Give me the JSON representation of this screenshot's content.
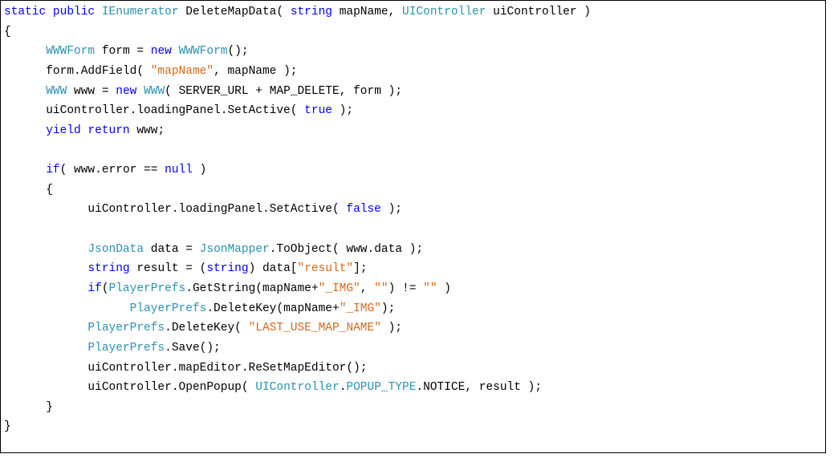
{
  "code": {
    "tokens": [
      [
        {
          "t": "static public",
          "c": "kw-blue"
        },
        {
          "t": " ",
          "c": "plain"
        },
        {
          "t": "IEnumerator",
          "c": "kw-teal"
        },
        {
          "t": " DeleteMapData( ",
          "c": "plain"
        },
        {
          "t": "string",
          "c": "kw-blue"
        },
        {
          "t": " mapName, ",
          "c": "plain"
        },
        {
          "t": "UIController",
          "c": "kw-teal"
        },
        {
          "t": " uiController )",
          "c": "plain"
        }
      ],
      [
        {
          "t": "{",
          "c": "plain"
        }
      ],
      [
        {
          "t": "      ",
          "c": "plain"
        },
        {
          "t": "WWWForm",
          "c": "kw-teal"
        },
        {
          "t": " form = ",
          "c": "plain"
        },
        {
          "t": "new",
          "c": "kw-blue"
        },
        {
          "t": " ",
          "c": "plain"
        },
        {
          "t": "WWWForm",
          "c": "kw-teal"
        },
        {
          "t": "();",
          "c": "plain"
        }
      ],
      [
        {
          "t": "      form.AddField( ",
          "c": "plain"
        },
        {
          "t": "\"mapName\"",
          "c": "str"
        },
        {
          "t": ", mapName );",
          "c": "plain"
        }
      ],
      [
        {
          "t": "      ",
          "c": "plain"
        },
        {
          "t": "WWW",
          "c": "kw-teal"
        },
        {
          "t": " www = ",
          "c": "plain"
        },
        {
          "t": "new",
          "c": "kw-blue"
        },
        {
          "t": " ",
          "c": "plain"
        },
        {
          "t": "WWW",
          "c": "kw-teal"
        },
        {
          "t": "( SERVER_URL + MAP_DELETE, form );",
          "c": "plain"
        }
      ],
      [
        {
          "t": "      uiController.loadingPanel.SetActive( ",
          "c": "plain"
        },
        {
          "t": "true",
          "c": "kw-blue"
        },
        {
          "t": " );",
          "c": "plain"
        }
      ],
      [
        {
          "t": "      ",
          "c": "plain"
        },
        {
          "t": "yield return",
          "c": "kw-blue"
        },
        {
          "t": " www;",
          "c": "plain"
        }
      ],
      [
        {
          "t": " ",
          "c": "plain"
        }
      ],
      [
        {
          "t": "      ",
          "c": "plain"
        },
        {
          "t": "if",
          "c": "kw-blue"
        },
        {
          "t": "( www.error == ",
          "c": "plain"
        },
        {
          "t": "null",
          "c": "kw-blue"
        },
        {
          "t": " )",
          "c": "plain"
        }
      ],
      [
        {
          "t": "      {",
          "c": "plain"
        }
      ],
      [
        {
          "t": "            uiController.loadingPanel.SetActive( ",
          "c": "plain"
        },
        {
          "t": "false",
          "c": "kw-blue"
        },
        {
          "t": " );",
          "c": "plain"
        }
      ],
      [
        {
          "t": " ",
          "c": "plain"
        }
      ],
      [
        {
          "t": "            ",
          "c": "plain"
        },
        {
          "t": "JsonData",
          "c": "kw-teal"
        },
        {
          "t": " data = ",
          "c": "plain"
        },
        {
          "t": "JsonMapper",
          "c": "kw-teal"
        },
        {
          "t": ".ToObject( www.data );",
          "c": "plain"
        }
      ],
      [
        {
          "t": "            ",
          "c": "plain"
        },
        {
          "t": "string",
          "c": "kw-blue"
        },
        {
          "t": " result = (",
          "c": "plain"
        },
        {
          "t": "string",
          "c": "kw-blue"
        },
        {
          "t": ") data[",
          "c": "plain"
        },
        {
          "t": "\"result\"",
          "c": "str"
        },
        {
          "t": "];",
          "c": "plain"
        }
      ],
      [
        {
          "t": "            ",
          "c": "plain"
        },
        {
          "t": "if",
          "c": "kw-blue"
        },
        {
          "t": "(",
          "c": "plain"
        },
        {
          "t": "PlayerPrefs",
          "c": "kw-teal"
        },
        {
          "t": ".GetString(mapName+",
          "c": "plain"
        },
        {
          "t": "\"_IMG\"",
          "c": "str"
        },
        {
          "t": ", ",
          "c": "plain"
        },
        {
          "t": "\"\"",
          "c": "str"
        },
        {
          "t": ") != ",
          "c": "plain"
        },
        {
          "t": "\"\"",
          "c": "str"
        },
        {
          "t": " )",
          "c": "plain"
        }
      ],
      [
        {
          "t": "                  ",
          "c": "plain"
        },
        {
          "t": "PlayerPrefs",
          "c": "kw-teal"
        },
        {
          "t": ".DeleteKey(mapName+",
          "c": "plain"
        },
        {
          "t": "\"_IMG\"",
          "c": "str"
        },
        {
          "t": ");",
          "c": "plain"
        }
      ],
      [
        {
          "t": "            ",
          "c": "plain"
        },
        {
          "t": "PlayerPrefs",
          "c": "kw-teal"
        },
        {
          "t": ".DeleteKey( ",
          "c": "plain"
        },
        {
          "t": "\"LAST_USE_MAP_NAME\"",
          "c": "str"
        },
        {
          "t": " );",
          "c": "plain"
        }
      ],
      [
        {
          "t": "            ",
          "c": "plain"
        },
        {
          "t": "PlayerPrefs",
          "c": "kw-teal"
        },
        {
          "t": ".Save();",
          "c": "plain"
        }
      ],
      [
        {
          "t": "            uiController.mapEditor.ReSetMapEditor();",
          "c": "plain"
        }
      ],
      [
        {
          "t": "            uiController.OpenPopup( ",
          "c": "plain"
        },
        {
          "t": "UIController",
          "c": "kw-teal"
        },
        {
          "t": ".",
          "c": "plain"
        },
        {
          "t": "POPUP_TYPE",
          "c": "kw-teal"
        },
        {
          "t": ".NOTICE, result );",
          "c": "plain"
        }
      ],
      [
        {
          "t": "      }",
          "c": "plain"
        }
      ],
      [
        {
          "t": "}",
          "c": "plain"
        }
      ]
    ]
  }
}
